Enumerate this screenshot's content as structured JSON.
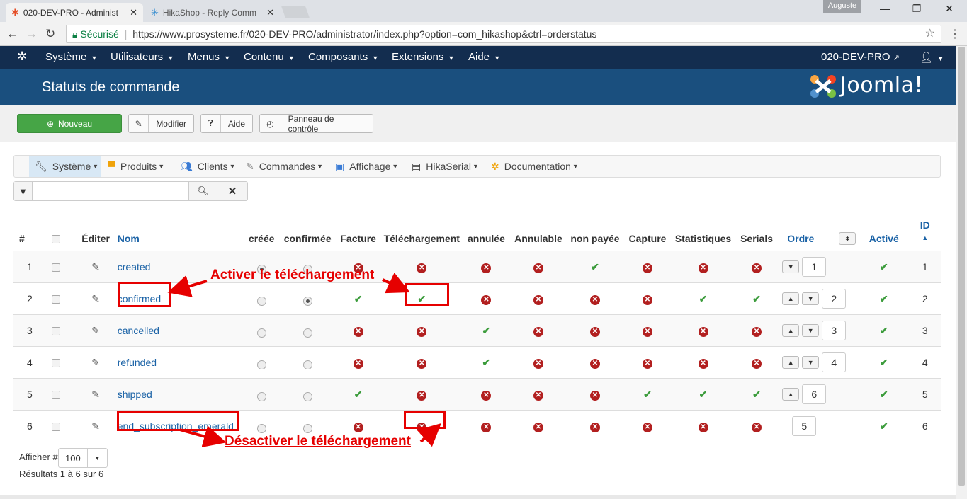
{
  "browser": {
    "tabs": [
      {
        "title": "020-DEV-PRO - Administ",
        "close": "✕"
      },
      {
        "title": "HikaShop - Reply Comm",
        "close": "✕"
      }
    ],
    "user_badge": "Auguste",
    "secure_label": "Sécurisé",
    "url": "https://www.prosysteme.fr/020-DEV-PRO/administrator/index.php?option=com_hikashop&ctrl=orderstatus"
  },
  "joomla_nav": {
    "items": [
      "Système",
      "Utilisateurs",
      "Menus",
      "Contenu",
      "Composants",
      "Extensions",
      "Aide"
    ],
    "site_name": "020-DEV-PRO"
  },
  "header": {
    "title": "Statuts de commande",
    "logo_text": "Joomla!"
  },
  "toolbar": {
    "new_label": "Nouveau",
    "edit_label": "Modifier",
    "help_label": "Aide",
    "control_panel_label": "Panneau de contrôle"
  },
  "hika_menu": {
    "items": [
      "Système",
      "Produits",
      "Clients",
      "Commandes",
      "Affichage",
      "HikaSerial",
      "Documentation"
    ]
  },
  "search": {
    "value": ""
  },
  "table": {
    "headers": {
      "num": "#",
      "edit": "Éditer",
      "name": "Nom",
      "created": "créée",
      "confirmed": "confirmée",
      "invoice": "Facture",
      "download": "Téléchargement",
      "cancelled": "annulée",
      "cancellable": "Annulable",
      "unpaid": "non payée",
      "capture": "Capture",
      "statistics": "Statistiques",
      "serials": "Serials",
      "order": "Ordre",
      "active": "Activé",
      "id": "ID"
    },
    "rows": [
      {
        "num": "1",
        "name": "created",
        "created": true,
        "confirmed": false,
        "invoice": false,
        "download": false,
        "cancelled": false,
        "cancellable": false,
        "unpaid": true,
        "capture": false,
        "statistics": false,
        "serials": false,
        "order": "1",
        "up": false,
        "down": true,
        "active": true,
        "id": "1"
      },
      {
        "num": "2",
        "name": "confirmed",
        "created": false,
        "confirmed": true,
        "invoice": true,
        "download": true,
        "cancelled": false,
        "cancellable": false,
        "unpaid": false,
        "capture": false,
        "statistics": true,
        "serials": true,
        "order": "2",
        "up": true,
        "down": true,
        "active": true,
        "id": "2"
      },
      {
        "num": "3",
        "name": "cancelled",
        "created": false,
        "confirmed": false,
        "invoice": false,
        "download": false,
        "cancelled": true,
        "cancellable": false,
        "unpaid": false,
        "capture": false,
        "statistics": false,
        "serials": false,
        "order": "3",
        "up": true,
        "down": true,
        "active": true,
        "id": "3"
      },
      {
        "num": "4",
        "name": "refunded",
        "created": false,
        "confirmed": false,
        "invoice": false,
        "download": false,
        "cancelled": true,
        "cancellable": false,
        "unpaid": false,
        "capture": false,
        "statistics": false,
        "serials": false,
        "order": "4",
        "up": true,
        "down": true,
        "active": true,
        "id": "4"
      },
      {
        "num": "5",
        "name": "shipped",
        "created": false,
        "confirmed": false,
        "invoice": true,
        "download": false,
        "cancelled": false,
        "cancellable": false,
        "unpaid": false,
        "capture": true,
        "statistics": true,
        "serials": true,
        "order": "6",
        "up": true,
        "down": false,
        "active": true,
        "id": "5"
      },
      {
        "num": "6",
        "name": "end_subscription_emerald",
        "created": false,
        "confirmed": false,
        "invoice": false,
        "download": false,
        "cancelled": false,
        "cancellable": false,
        "unpaid": false,
        "capture": false,
        "statistics": false,
        "serials": false,
        "order": "5",
        "up": false,
        "down": false,
        "active": true,
        "id": "6"
      }
    ]
  },
  "annotations": {
    "activate": "Activer le téléchargement",
    "deactivate": "Désactiver le téléchargement"
  },
  "footer": {
    "display_label": "Afficher #",
    "limit_value": "100",
    "results": "Résultats 1 à 6 sur 6"
  }
}
